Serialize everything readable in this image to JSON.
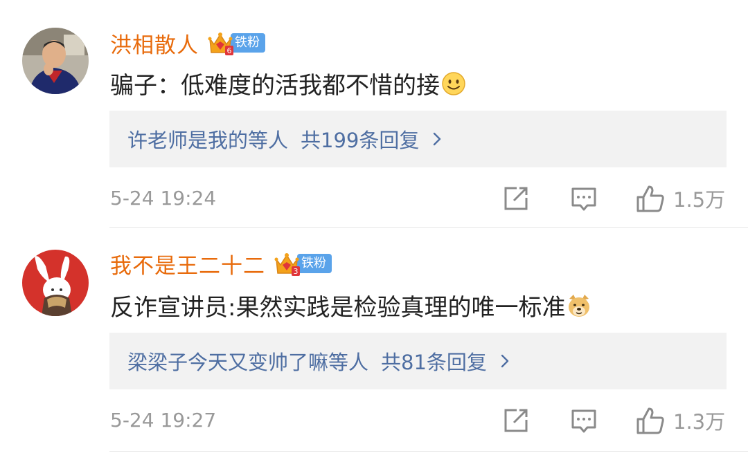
{
  "comments": [
    {
      "username": "洪相散人",
      "badge": {
        "label": "铁粉",
        "level": "6"
      },
      "text": "骗子：低难度的活我都不惜的接",
      "emoji": "smile-emoji",
      "reply_preview": "许老师是我的等人",
      "reply_count": "共199条回复",
      "timestamp": "5-24 19:24",
      "likes": "1.5万"
    },
    {
      "username": "我不是王二十二",
      "badge": {
        "label": "铁粉",
        "level": "3"
      },
      "text": "反诈宣讲员:果然实践是检验真理的唯一标准",
      "emoji": "doge-emoji",
      "reply_preview": "梁梁子今天又变帅了嘛等人",
      "reply_count": "共81条回复",
      "timestamp": "5-24 19:27",
      "likes": "1.3万"
    }
  ],
  "colors": {
    "username": "#e86b0c",
    "reply_link": "#4e6ea2",
    "badge": "#5aa3ea",
    "meta": "#999999",
    "reply_bg": "#f2f2f2"
  }
}
